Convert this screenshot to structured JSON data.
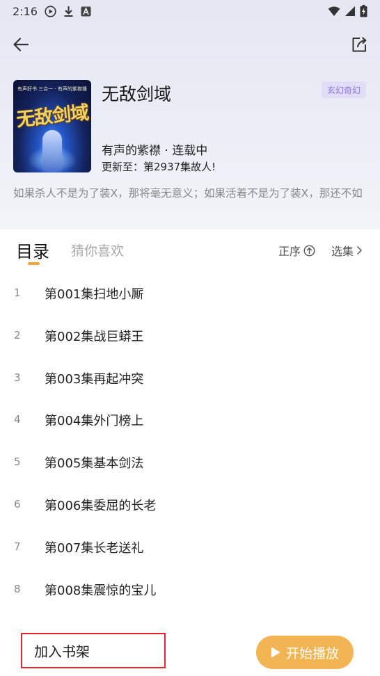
{
  "status_bar": {
    "time": "2:16",
    "icons": [
      "play-circle-icon",
      "download-icon",
      "a-box-icon",
      "wifi-icon",
      "signal-icon",
      "battery-charging-icon"
    ]
  },
  "nav": {
    "back_icon": "arrow-left-icon",
    "share_icon": "share-icon"
  },
  "book": {
    "cover_tagline": "有声好书 三合一 · 有声的紫襟播出作品",
    "cover_title": "无敌剑域",
    "title": "无敌剑域",
    "genre": "玄幻奇幻",
    "author_status": "有声的紫襟 · 连载中",
    "update": "更新至：第2937集故人!",
    "description": "如果杀人不是为了装X，那将毫无意义；如果活着不是为了装X，那还不如"
  },
  "tabs": {
    "catalog": "目录",
    "recommend": "猜你喜欢",
    "sort_label": "正序",
    "select_label": "选集"
  },
  "episodes": [
    {
      "num": "1",
      "title": "第001集扫地小厮"
    },
    {
      "num": "2",
      "title": "第002集战巨蟒王"
    },
    {
      "num": "3",
      "title": "第003集再起冲突"
    },
    {
      "num": "4",
      "title": "第004集外门榜上"
    },
    {
      "num": "5",
      "title": "第005集基本剑法"
    },
    {
      "num": "6",
      "title": "第006集委屈的长老"
    },
    {
      "num": "7",
      "title": "第007集长老送礼"
    },
    {
      "num": "8",
      "title": "第008集震惊的宝儿"
    }
  ],
  "bottom": {
    "add_shelf": "加入书架",
    "play": "开始播放"
  },
  "colors": {
    "accent": "#f0a53b",
    "play_button": "#f3b454",
    "genre_bg": "#e1dcf7",
    "genre_text": "#8a76d6",
    "highlight_border": "#e6262a"
  }
}
